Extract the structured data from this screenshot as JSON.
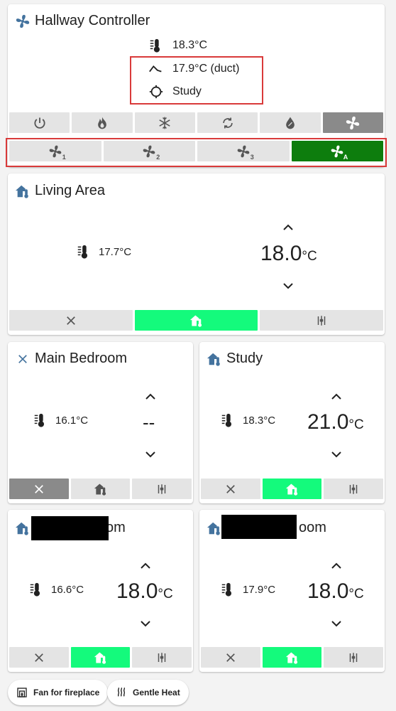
{
  "hallway": {
    "title": "Hallway Controller",
    "current_temp": "18.3°C",
    "duct_temp": "17.9°C (duct)",
    "sensor": "Study",
    "modes": [
      "power-icon",
      "flame-icon",
      "snowflake-icon",
      "cycle-icon",
      "dry-icon",
      "fan-icon"
    ],
    "active_mode": "fan",
    "fan_speeds": [
      "fan-speed-1-icon",
      "fan-speed-2-icon",
      "fan-speed-3-icon",
      "fan-speed-auto-icon"
    ],
    "active_fan_speed": "auto"
  },
  "living": {
    "title": "Living Area",
    "current_temp": "17.7°C",
    "target_value": "18.0",
    "target_unit": "°C",
    "active_mode": "heat"
  },
  "main_bedroom": {
    "title": "Main Bedroom",
    "current_temp": "16.1°C",
    "target_value": "--",
    "active_mode": "off"
  },
  "study": {
    "title": "Study",
    "current_temp": "18.3°C",
    "target_value": "21.0",
    "target_unit": "°C",
    "active_mode": "heat"
  },
  "room_a": {
    "title_visible": "om",
    "current_temp": "16.6°C",
    "target_value": "18.0",
    "target_unit": "°C",
    "active_mode": "heat"
  },
  "room_b": {
    "title_visible": "oom",
    "current_temp": "17.9°C",
    "target_value": "18.0",
    "target_unit": "°C",
    "active_mode": "heat"
  },
  "scenes": {
    "fan_fireplace": "Fan for fireplace",
    "gentle_heat": "Gentle Heat"
  },
  "colors": {
    "accent_blue": "#44739e",
    "active_green": "#0d7d0d",
    "active_mint": "#14fa7c",
    "highlight_red": "#d93a3a"
  }
}
